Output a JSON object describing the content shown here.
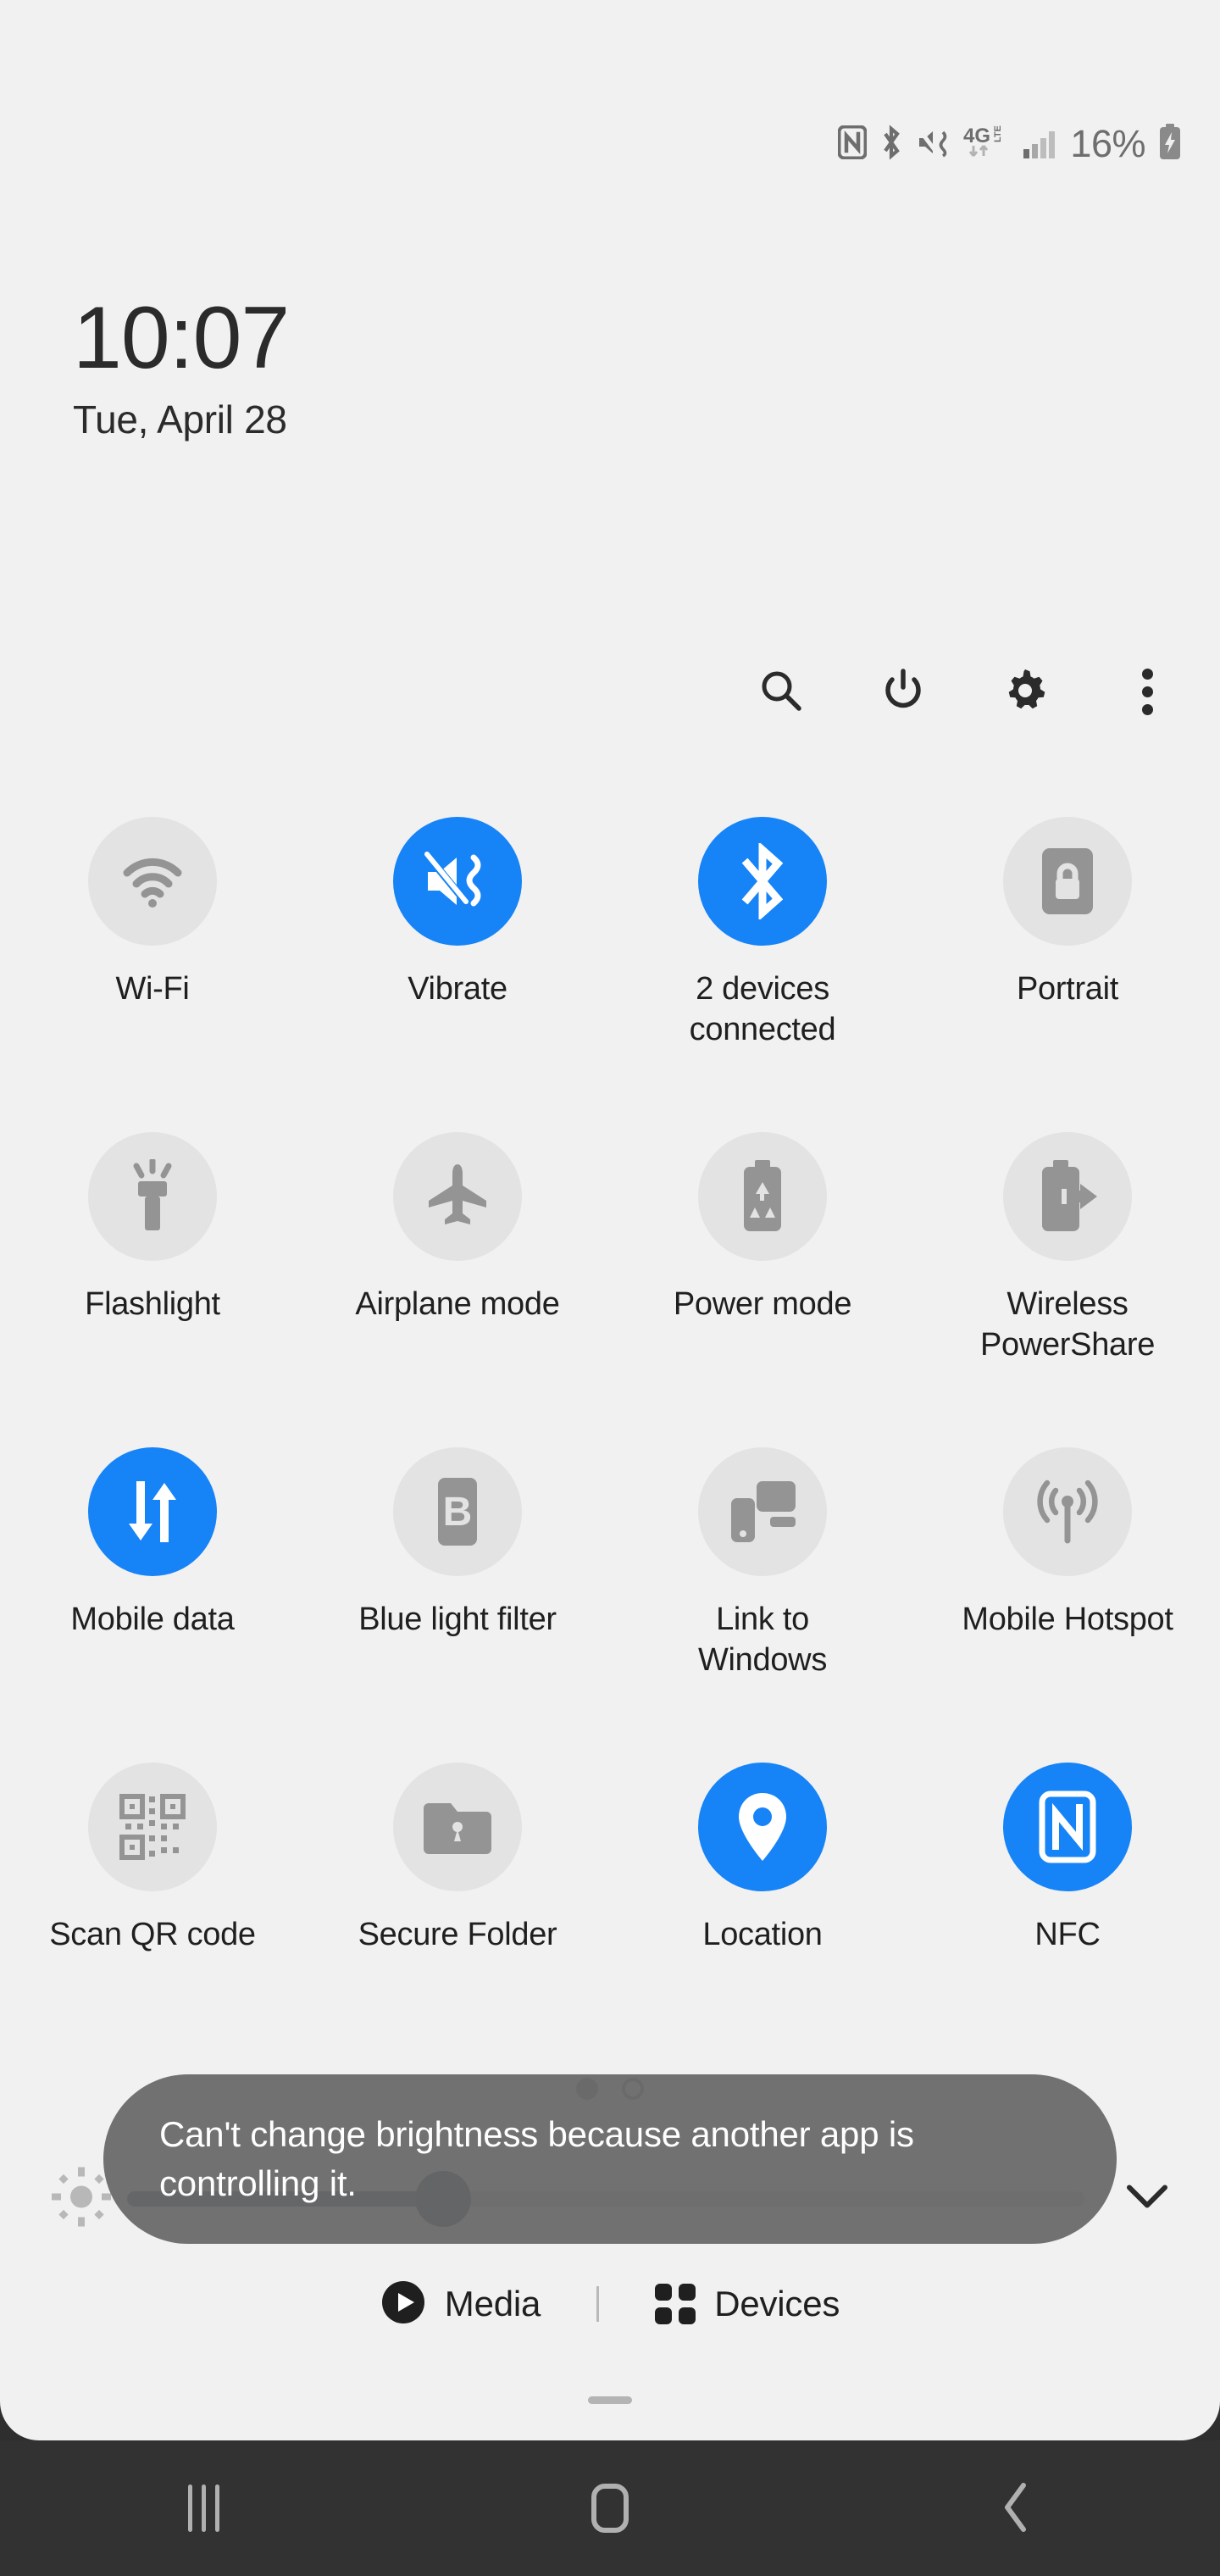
{
  "statusbar": {
    "icons": [
      "nfc-icon",
      "bluetooth-icon",
      "vibrate-icon",
      "4glte-data-icon",
      "signal-bars-icon"
    ],
    "battery_percent": "16%",
    "battery_state": "charging"
  },
  "clock": {
    "time": "10:07",
    "date": "Tue, April 28"
  },
  "toolbar": {
    "search_label": "Search",
    "power_label": "Power off",
    "settings_label": "Settings",
    "more_label": "More options"
  },
  "tiles": [
    {
      "label": "Wi-Fi",
      "icon": "wifi-icon",
      "state": "off"
    },
    {
      "label": "Vibrate",
      "icon": "vibrate-icon",
      "state": "on"
    },
    {
      "label": "2 devices connected",
      "icon": "bluetooth-icon",
      "state": "on"
    },
    {
      "label": "Portrait",
      "icon": "screen-rotation-lock-icon",
      "state": "off"
    },
    {
      "label": "Flashlight",
      "icon": "flashlight-icon",
      "state": "off"
    },
    {
      "label": "Airplane mode",
      "icon": "airplane-icon",
      "state": "off"
    },
    {
      "label": "Power mode",
      "icon": "battery-recycle-icon",
      "state": "off"
    },
    {
      "label": "Wireless PowerShare",
      "icon": "battery-share-icon",
      "state": "off"
    },
    {
      "label": "Mobile data",
      "icon": "data-arrows-icon",
      "state": "on"
    },
    {
      "label": "Blue light filter",
      "icon": "blue-light-b-icon",
      "state": "off"
    },
    {
      "label": "Link to Windows",
      "icon": "link-to-windows-icon",
      "state": "off"
    },
    {
      "label": "Mobile Hotspot",
      "icon": "hotspot-antenna-icon",
      "state": "off"
    },
    {
      "label": "Scan QR code",
      "icon": "qr-code-icon",
      "state": "off"
    },
    {
      "label": "Secure Folder",
      "icon": "secure-folder-icon",
      "state": "off"
    },
    {
      "label": "Location",
      "icon": "location-pin-icon",
      "state": "on"
    },
    {
      "label": "NFC",
      "icon": "nfc-icon",
      "state": "on"
    }
  ],
  "brightness": {
    "value_percent": 33,
    "left_icon": "brightness-sun-icon",
    "expand_icon": "chevron-down-icon"
  },
  "pages": {
    "count": 2,
    "active_index": 0
  },
  "toast": {
    "message": "Can't change brightness because another app is controlling it."
  },
  "footer": {
    "media_label": "Media",
    "devices_label": "Devices"
  },
  "navbar": {
    "recents_label": "Recents",
    "home_label": "Home",
    "back_label": "Back"
  },
  "colors": {
    "accent_blue": "#1683f7",
    "tile_off_bg": "#e3e3e3",
    "tile_off_fg": "#949494",
    "panel_bg": "#f1f1f1",
    "navbar_bg": "#323232",
    "toast_bg": "#666666"
  }
}
